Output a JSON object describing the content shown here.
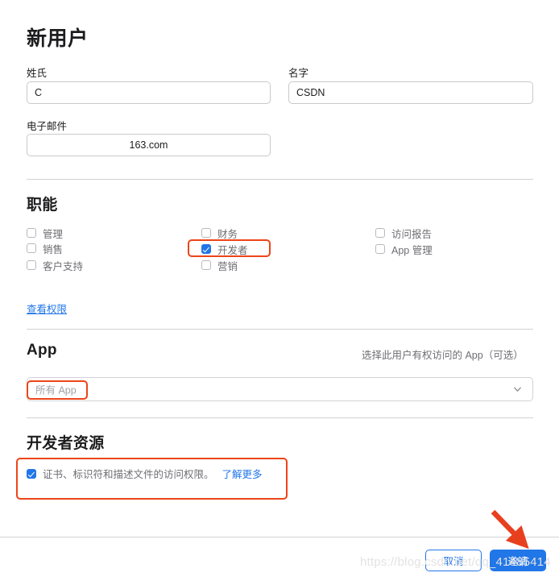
{
  "page": {
    "title": "新用户"
  },
  "name_fields": {
    "last_name": {
      "label": "姓氏",
      "value": "C"
    },
    "first_name": {
      "label": "名字",
      "value": "CSDN"
    },
    "email": {
      "label": "电子邮件",
      "value": "163.com"
    }
  },
  "roles_section": {
    "title": "职能",
    "columns": [
      [
        {
          "label": "管理",
          "checked": false
        },
        {
          "label": "销售",
          "checked": false
        },
        {
          "label": "客户支持",
          "checked": false
        }
      ],
      [
        {
          "label": "财务",
          "checked": false
        },
        {
          "label": "开发者",
          "checked": true
        },
        {
          "label": "营销",
          "checked": false
        }
      ],
      [
        {
          "label": "访问报告",
          "checked": false
        },
        {
          "label": "App 管理",
          "checked": false
        }
      ]
    ],
    "permissions_link": "查看权限"
  },
  "app_section": {
    "title": "App",
    "helper": "选择此用户有权访问的 App（可选）",
    "select_placeholder": "所有 App",
    "chevron_icon": "chevron-down-icon"
  },
  "dev_resources_section": {
    "title": "开发者资源",
    "checkbox": {
      "label": "证书、标识符和描述文件的访问权限。",
      "checked": true
    },
    "learn_more": "了解更多"
  },
  "footer": {
    "cancel_label": "取消",
    "invite_label": "邀请"
  },
  "watermark": {
    "text": "https://blog.csdn.net/qq_41485414"
  },
  "colors": {
    "accent_blue": "#2176e8",
    "annotation_orange": "#ec4519",
    "annotation_red_arrow": "#e8401f",
    "muted_text": "#6e6e73",
    "border": "#d2d2d7"
  }
}
